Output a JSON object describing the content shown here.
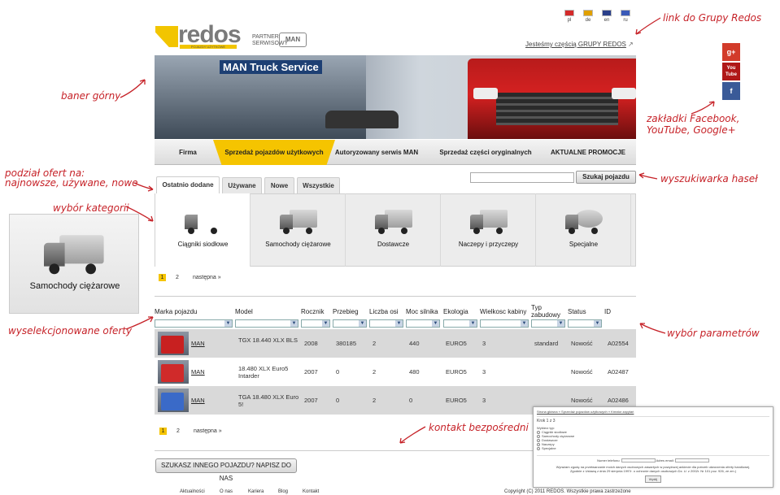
{
  "header": {
    "logo_text": "redos",
    "logo_sub": "POJAZDY UŻYTKOWE",
    "partner_label": "PARTNER SERWISOWY",
    "man_logo": "MAN",
    "languages": [
      {
        "code": "pl",
        "color": "#d42a2a"
      },
      {
        "code": "de",
        "color": "#e0a000"
      },
      {
        "code": "en",
        "color": "#2a3f8a"
      },
      {
        "code": "ru",
        "color": "#3a5ab8"
      }
    ],
    "group_link": "Jesteśmy częścią GRUPY REDOS"
  },
  "social": [
    {
      "name": "google-plus-icon",
      "label": "g+",
      "color": "#d23b2a"
    },
    {
      "name": "youtube-icon",
      "label": "You Tube",
      "color": "#b01818"
    },
    {
      "name": "facebook-icon",
      "label": "f",
      "color": "#3a5a98"
    }
  ],
  "banner": {
    "sign": "MAN Truck Service"
  },
  "nav": {
    "items": [
      "Firma",
      "Sprzedaż pojazdów użytkowych",
      "Autoryzowany serwis MAN",
      "Sprzedaż części oryginalnych",
      "AKTUALNE PROMOCJE"
    ],
    "active": 1
  },
  "tabs": {
    "items": [
      "Ostatnio dodane",
      "Używane",
      "Nowe",
      "Wszystkie"
    ],
    "active": 0
  },
  "search": {
    "placeholder": "",
    "button": "Szukaj pojazdu"
  },
  "categories": {
    "items": [
      "Ciągniki siodłowe",
      "Samochody ciężarowe",
      "Dostawcze",
      "Naczepy i przyczepy",
      "Specjalne"
    ],
    "active": 0
  },
  "side_category": {
    "label": "Samochody ciężarowe"
  },
  "pagination": {
    "pages": [
      "1",
      "2"
    ],
    "current": "1",
    "next": "następna »"
  },
  "table": {
    "headers": [
      "Marka pojazdu",
      "Model",
      "Rocznik",
      "Przebieg",
      "Liczba osi",
      "Moc silnika",
      "Ekologia",
      "Wielkosc kabiny",
      "Typ zabudowy",
      "Status",
      "ID"
    ],
    "rows": [
      {
        "brand": "MAN",
        "model": "TGX 18.440 XLX BLS",
        "year": "2008",
        "mileage": "380185",
        "axles": "2",
        "power": "440",
        "eco": "EURO5",
        "cab": "3",
        "body": "standard",
        "status": "Nowość",
        "id": "A02554",
        "color": "#c82020"
      },
      {
        "brand": "MAN",
        "model": "18.480 XLX Euro5 Intarder",
        "year": "2007",
        "mileage": "0",
        "axles": "2",
        "power": "480",
        "eco": "EURO5",
        "cab": "3",
        "body": "",
        "status": "Nowość",
        "id": "A02487",
        "color": "#d02a2a"
      },
      {
        "brand": "MAN",
        "model": "TGA 18.480 XLX Euro 5!",
        "year": "2007",
        "mileage": "0",
        "axles": "2",
        "power": "0",
        "eco": "EURO5",
        "cab": "3",
        "body": "",
        "status": "Nowość",
        "id": "A02486",
        "color": "#3a6ac8"
      }
    ]
  },
  "cta": "SZUKASZ INNEGO POJAZDU? NAPISZ DO NAS",
  "footer": {
    "links": [
      "Aktualności",
      "O nas",
      "Kariera",
      "Blog",
      "Kontakt"
    ],
    "copyright": "Copyright (C) 2011 REDOS. Wszystkie prawa zastrzeżone"
  },
  "inset": {
    "breadcrumb": "Strona główna » Sprzedaż pojazdów użytkowych » Kreator zapytań",
    "step": "Krok 1 z 3",
    "question": "Wybierz typ:",
    "options": [
      "Ciągniki siodłowe",
      "Samochody ciężarowe",
      "Dostawcze",
      "Naczepy",
      "Specjalne"
    ],
    "phone_label": "Numer telefonu:",
    "email_label": "Adres email:",
    "consent": "Wyrażam zgodę na przetwarzanie moich danych osobowych zawartych w powyższej ankiecie dla potrzeb utworzenia oferty handlowej. Zgodnie z Ustawą z dnia 29 sierpnia 1997r. o ochronie danych osobowych Dz. U. z 2002r. Nr 101 poz. 926, ze zm.)",
    "send": "Wyślij"
  },
  "annotations": {
    "group_link": "link do Grupy Redos",
    "banner": "baner górny",
    "social": "zakładki Facebook, YouTube, Google+",
    "offers_split": "podział ofert na: najnowsze, używane, nowe",
    "category": "wybór kategorii",
    "search": "wyszukiwarka haseł",
    "selected": "wyselekcjonowane oferty",
    "params": "wybór parametrów",
    "contact": "kontakt bezpośredni"
  },
  "colors": {
    "accent": "#f5c400",
    "annotation": "#c62228"
  }
}
